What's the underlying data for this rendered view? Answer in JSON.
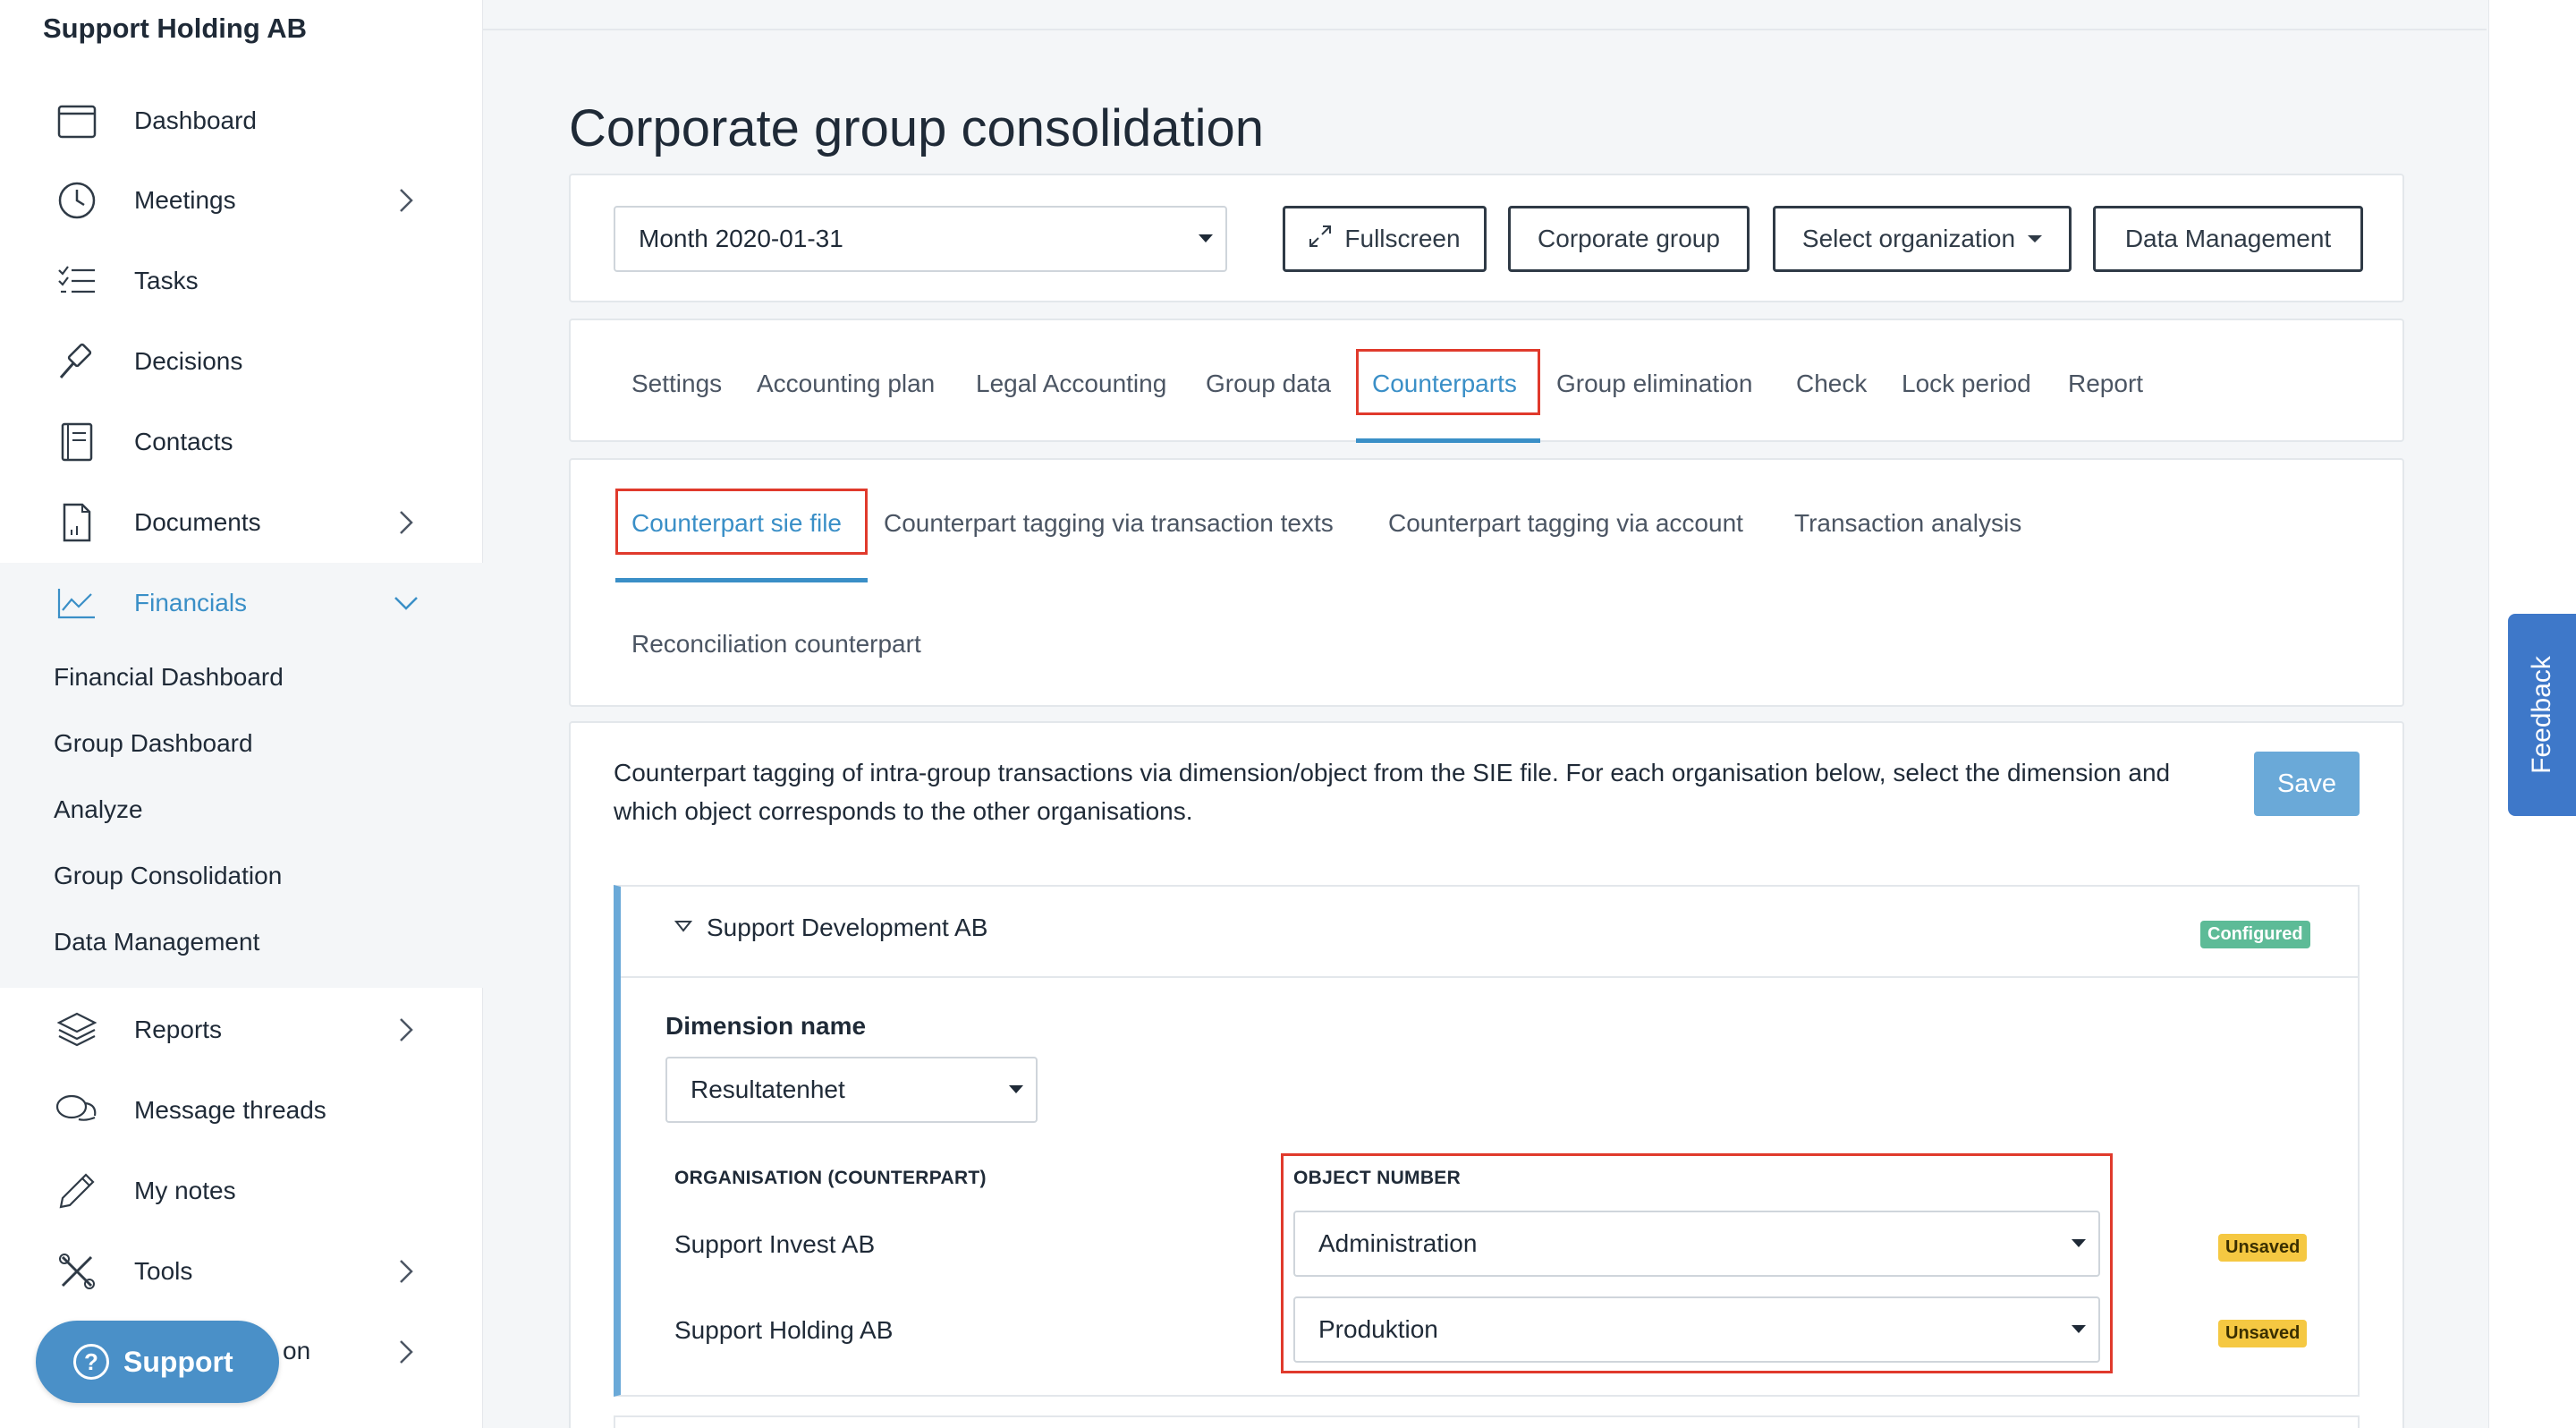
{
  "sidebar": {
    "org_name": "Support Holding AB",
    "items": [
      {
        "label": "Dashboard",
        "icon": "calendar-icon"
      },
      {
        "label": "Meetings",
        "icon": "clock-icon"
      },
      {
        "label": "Tasks",
        "icon": "checklist-icon"
      },
      {
        "label": "Decisions",
        "icon": "gavel-icon"
      },
      {
        "label": "Contacts",
        "icon": "contacts-book-icon"
      },
      {
        "label": "Documents",
        "icon": "document-icon"
      },
      {
        "label": "Financials",
        "icon": "line-chart-icon"
      },
      {
        "label": "Reports",
        "icon": "layers-icon"
      },
      {
        "label": "Message threads",
        "icon": "chat-bubbles-icon"
      },
      {
        "label": "My notes",
        "icon": "pencil-icon"
      },
      {
        "label": "Tools",
        "icon": "tools-icon"
      },
      {
        "label": "on"
      }
    ],
    "financials_sub": [
      "Financial Dashboard",
      "Group Dashboard",
      "Analyze",
      "Group Consolidation",
      "Data Management"
    ],
    "support_button": "Support"
  },
  "page": {
    "title": "Corporate group consolidation"
  },
  "toolbar": {
    "period_select": "Month 2020-01-31",
    "fullscreen": "Fullscreen",
    "corporate_group": "Corporate group",
    "select_org": "Select organization",
    "data_management": "Data Management"
  },
  "tabs": [
    "Settings",
    "Accounting plan",
    "Legal Accounting",
    "Group data",
    "Counterparts",
    "Group elimination",
    "Check",
    "Lock period",
    "Report"
  ],
  "subtabs": [
    "Counterpart sie file",
    "Counterpart tagging via transaction texts",
    "Counterpart tagging via account",
    "Transaction analysis",
    "Reconciliation counterpart"
  ],
  "content": {
    "description": "Counterpart tagging of intra-group transactions via dimension/object from the SIE file. For each organisation below, select the dimension and which object corresponds to the other organisations.",
    "save": "Save"
  },
  "panel": {
    "org_name": "Support Development AB",
    "status": "Configured",
    "dimension_label": "Dimension name",
    "dimension_value": "Resultatenhet",
    "col_org": "ORGANISATION (COUNTERPART)",
    "col_object": "OBJECT NUMBER",
    "rows": [
      {
        "org": "Support Invest AB",
        "object": "Administration",
        "status": "Unsaved"
      },
      {
        "org": "Support Holding AB",
        "object": "Produktion",
        "status": "Unsaved"
      }
    ]
  },
  "feedback": "Feedback",
  "colors": {
    "accent": "#3a8fc7",
    "highlight_red": "#e03a2c",
    "configured_green": "#5dbb97",
    "unsaved_yellow": "#f5c842",
    "feedback_blue": "#3e78c9"
  }
}
